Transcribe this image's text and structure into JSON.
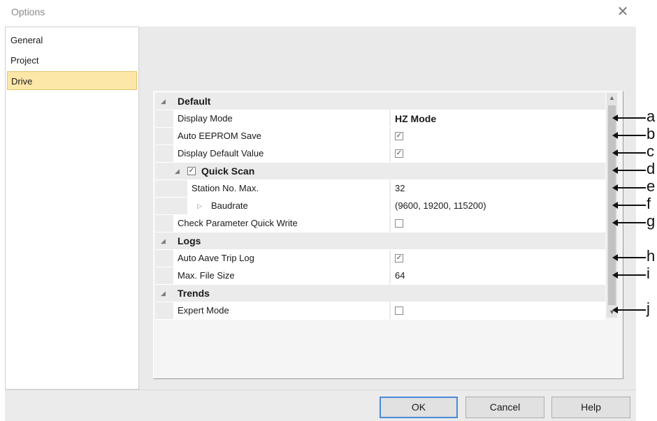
{
  "window": {
    "title": "Options",
    "close_symbol": "✕"
  },
  "sidebar": {
    "items": [
      {
        "label": "General"
      },
      {
        "label": "Project"
      },
      {
        "label": "Drive"
      }
    ],
    "selected": "Drive"
  },
  "grid": {
    "categories": {
      "default": "Default",
      "quick_scan": "Quick Scan",
      "logs": "Logs",
      "trends": "Trends"
    },
    "rows": {
      "display_mode": {
        "name": "Display Mode",
        "value": "HZ Mode"
      },
      "auto_eeprom_save": {
        "name": "Auto EEPROM Save",
        "checked": true
      },
      "display_default_value": {
        "name": "Display Default Value",
        "checked": true
      },
      "quick_scan_enabled": {
        "checked": true
      },
      "station_no_max": {
        "name": "Station No. Max.",
        "value": "32"
      },
      "baudrate": {
        "name": "Baudrate",
        "value": "(9600, 19200, 115200)"
      },
      "check_param_quick_write": {
        "name": "Check Parameter Quick Write",
        "checked": false
      },
      "auto_save_trip_log": {
        "name": "Auto Aave Trip Log",
        "checked": true
      },
      "max_file_size": {
        "name": "Max. File Size",
        "value": "64"
      },
      "expert_mode": {
        "name": "Expert Mode",
        "checked": false
      }
    },
    "check_symbol": "✓",
    "collapse_symbol": "◢",
    "expand_symbol": "▷"
  },
  "callouts": [
    "a",
    "b",
    "c",
    "d",
    "e",
    "f",
    "g",
    "h",
    "i",
    "j"
  ],
  "buttons": {
    "ok": "OK",
    "cancel": "Cancel",
    "help": "Help"
  },
  "colors": {
    "selected_nav_bg": "#fde7a8",
    "default_button_border": "#4a8ad6"
  }
}
